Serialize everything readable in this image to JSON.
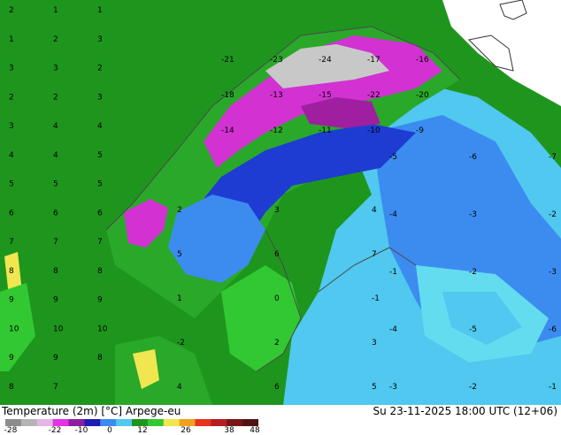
{
  "header": {
    "title": "Temperature (2m) [°C] Arpege-eu",
    "valid_time": "Su 23-11-2025 18:00 UTC (12+06)"
  },
  "legend": {
    "ticks": [
      "-28",
      "-22",
      "-10",
      "0",
      "12",
      "26",
      "38",
      "48"
    ],
    "colors": [
      "#8c8c8c",
      "#b4b4b4",
      "#e6b4e6",
      "#e632e6",
      "#8c1ea0",
      "#1e1eb4",
      "#3c8cf0",
      "#50c8f0",
      "#1e961e",
      "#32c832",
      "#f0e650",
      "#f0a01e",
      "#e6321e",
      "#b41e1e",
      "#781414",
      "#501414"
    ]
  },
  "map": {
    "sea_color": "#1e961e",
    "colors": {
      "mountain": "#d232d2",
      "mountain_dark": "#a01ea0",
      "snow_grey": "#c8c8c8",
      "cold_blue": "#1e3cd2",
      "mid_blue": "#3c8cf0",
      "light_blue": "#50c8f0",
      "cyan": "#64dcf0",
      "land_green": "#2aa82a",
      "bright_green": "#3cc83c",
      "yellow": "#f0e650",
      "coast_line": "#4a4a4a"
    }
  },
  "labels_text": {
    "west_sea": [
      "2",
      "1",
      "1",
      "1",
      "2",
      "3",
      "3",
      "3",
      "2",
      "2",
      "2",
      "3",
      "3",
      "4",
      "4",
      "4",
      "4",
      "5",
      "5",
      "5",
      "5",
      "6",
      "6",
      "6",
      "7",
      "7",
      "7",
      "8",
      "8",
      "8",
      "9",
      "9",
      "9",
      "10",
      "10",
      "10",
      "9",
      "9",
      "8",
      "8",
      "7"
    ],
    "mountains": [
      "-21",
      "-23",
      "-24",
      "-17",
      "-16",
      "-18",
      "-13",
      "-15",
      "-22",
      "-20",
      "-14",
      "-12",
      "-11",
      "-10",
      "-9"
    ],
    "east": [
      "-5",
      "-6",
      "-7",
      "-4",
      "-3",
      "-2",
      "-1",
      "-2",
      "-3",
      "-4",
      "-5",
      "-6",
      "-3",
      "-2",
      "-1"
    ],
    "south": [
      "2",
      "3",
      "4",
      "5",
      "6",
      "7",
      "1",
      "0",
      "-1",
      "-2",
      "2",
      "3",
      "4",
      "6",
      "5"
    ]
  }
}
